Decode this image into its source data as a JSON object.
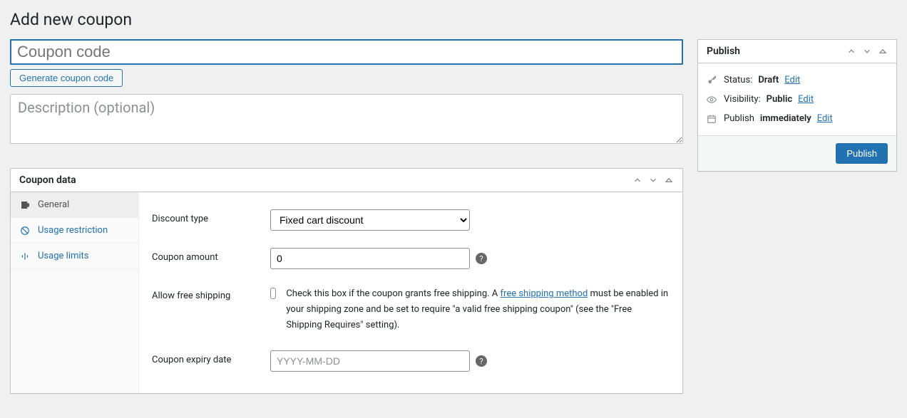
{
  "page_title": "Add new coupon",
  "coupon_code": {
    "value": "",
    "placeholder": "Coupon code"
  },
  "generate_button": "Generate coupon code",
  "description": {
    "value": "",
    "placeholder": "Description (optional)"
  },
  "coupon_data": {
    "title": "Coupon data",
    "tabs": [
      {
        "label": "General"
      },
      {
        "label": "Usage restriction"
      },
      {
        "label": "Usage limits"
      }
    ],
    "fields": {
      "discount_type": {
        "label": "Discount type",
        "value": "Fixed cart discount"
      },
      "coupon_amount": {
        "label": "Coupon amount",
        "value": "0"
      },
      "free_shipping": {
        "label": "Allow free shipping",
        "text_before": "Check this box if the coupon grants free shipping. A ",
        "link_text": "free shipping method",
        "text_after": " must be enabled in your shipping zone and be set to require \"a valid free shipping coupon\" (see the \"Free Shipping Requires\" setting)."
      },
      "expiry": {
        "label": "Coupon expiry date",
        "value": "",
        "placeholder": "YYYY-MM-DD"
      }
    }
  },
  "publish": {
    "title": "Publish",
    "status_label": "Status:",
    "status_value": "Draft",
    "visibility_label": "Visibility:",
    "visibility_value": "Public",
    "schedule_label": "Publish",
    "schedule_value": "immediately",
    "edit": "Edit",
    "button": "Publish"
  }
}
